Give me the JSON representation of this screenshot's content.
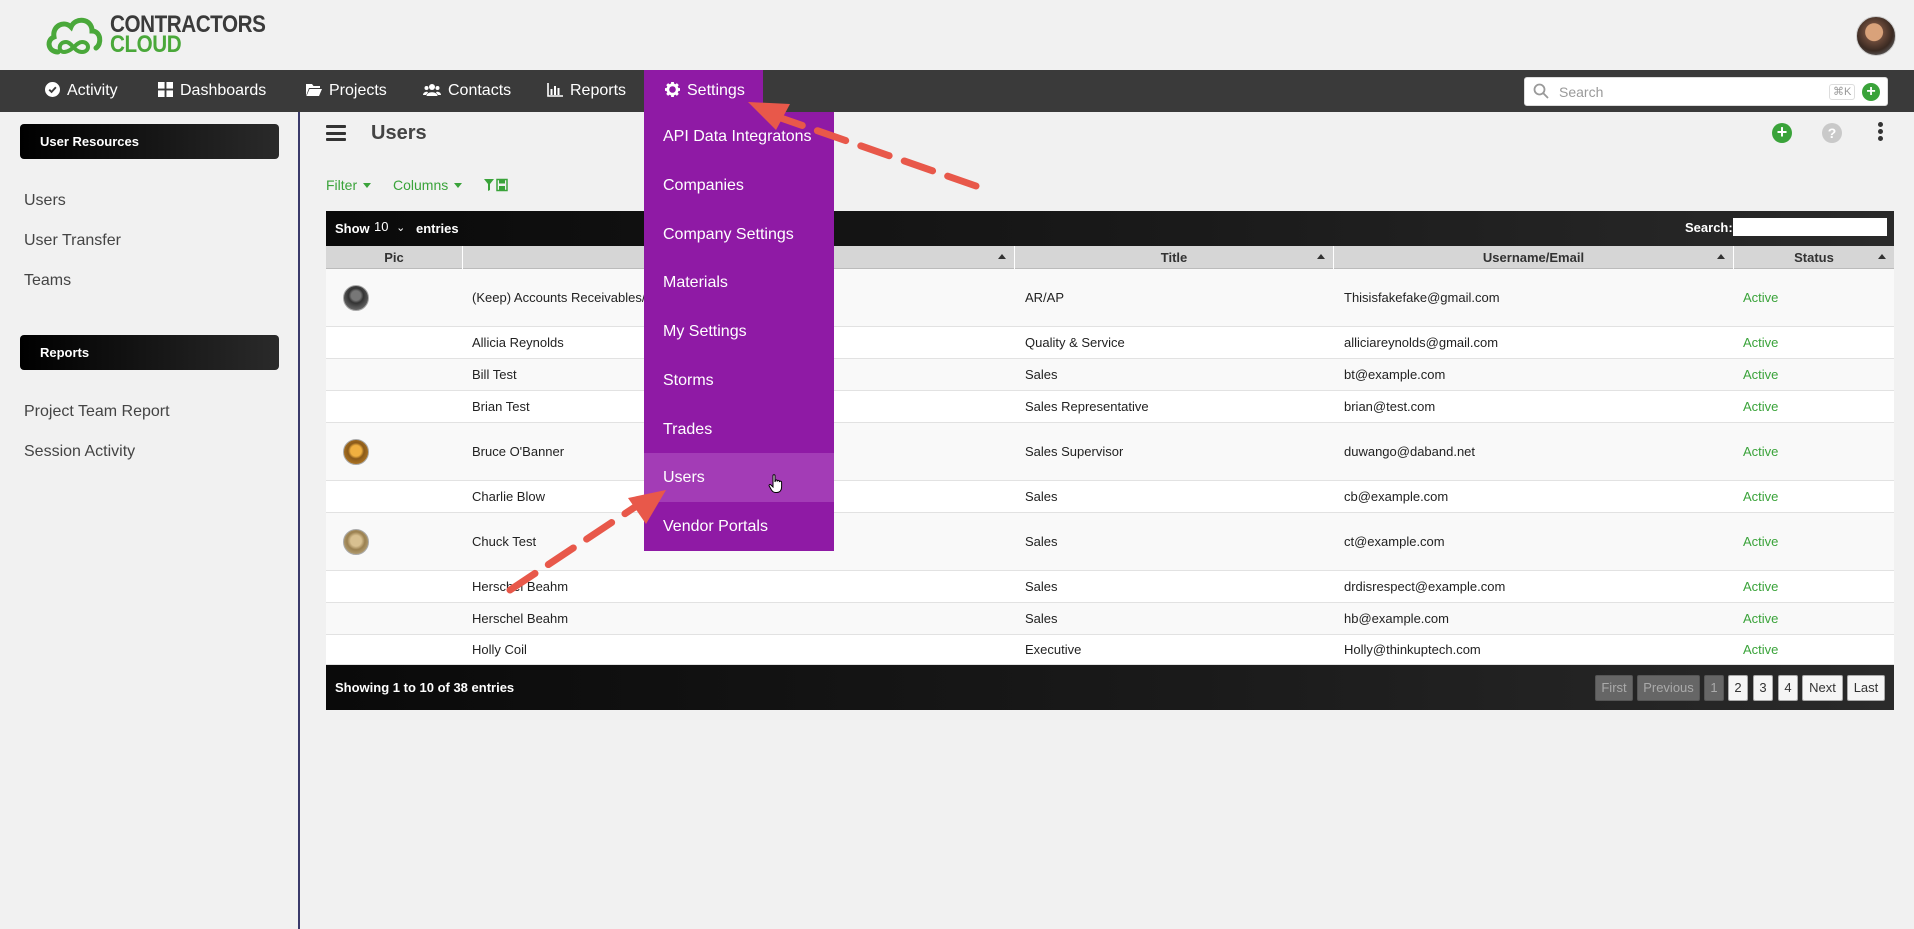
{
  "app": {
    "logo_line1": "CONTRACTORS",
    "logo_line2": "CLOUD",
    "brand_green": "#4aa83a",
    "accent_purple": "#8f1aa5"
  },
  "nav": {
    "items": [
      {
        "label": "Activity",
        "icon": "check-circle-icon"
      },
      {
        "label": "Dashboards",
        "icon": "grid-icon"
      },
      {
        "label": "Projects",
        "icon": "folder-open-icon"
      },
      {
        "label": "Contacts",
        "icon": "users-icon"
      },
      {
        "label": "Reports",
        "icon": "bar-chart-icon"
      },
      {
        "label": "Settings",
        "icon": "gear-icon"
      }
    ],
    "search_placeholder": "Search",
    "search_shortcut": "⌘K"
  },
  "sidebar": {
    "section1_title": "User Resources",
    "section1_items": [
      "Users",
      "User Transfer",
      "Teams"
    ],
    "section2_title": "Reports",
    "section2_items": [
      "Project Team Report",
      "Session Activity"
    ]
  },
  "page": {
    "title": "Users",
    "filter_label": "Filter",
    "columns_label": "Columns"
  },
  "table": {
    "show_label": "Show",
    "page_size": "10",
    "entries_label": "entries",
    "search_label": "Search:",
    "columns": [
      "Pic",
      "",
      "Title",
      "Username/Email",
      "Status"
    ],
    "rows": [
      {
        "name": "(Keep) Accounts Receivables/",
        "title": "AR/AP",
        "email": "Thisisfakefake@gmail.com",
        "status": "Active",
        "pic": "avatar-dark"
      },
      {
        "name": "Allicia Reynolds",
        "title": "Quality & Service",
        "email": "alliciareynolds@gmail.com",
        "status": "Active",
        "pic": ""
      },
      {
        "name": "Bill Test",
        "title": "Sales",
        "email": "bt@example.com",
        "status": "Active",
        "pic": ""
      },
      {
        "name": "Brian Test",
        "title": "Sales Representative",
        "email": "brian@test.com",
        "status": "Active",
        "pic": ""
      },
      {
        "name": "Bruce O'Banner",
        "title": "Sales Supervisor",
        "email": "duwango@daband.net",
        "status": "Active",
        "pic": "avatar-orange"
      },
      {
        "name": "Charlie Blow",
        "title": "Sales",
        "email": "cb@example.com",
        "status": "Active",
        "pic": ""
      },
      {
        "name": "Chuck Test",
        "title": "Sales",
        "email": "ct@example.com",
        "status": "Active",
        "pic": "avatar-tan"
      },
      {
        "name": "Herschel Beahm",
        "title": "Sales",
        "email": "drdisrespect@example.com",
        "status": "Active",
        "pic": ""
      },
      {
        "name": "Herschel Beahm",
        "title": "Sales",
        "email": "hb@example.com",
        "status": "Active",
        "pic": ""
      },
      {
        "name": "Holly Coil",
        "title": "Executive",
        "email": "Holly@thinkuptech.com",
        "status": "Active",
        "pic": ""
      }
    ],
    "info": "Showing 1 to 10 of 38 entries",
    "pagination": [
      "First",
      "Previous",
      "1",
      "2",
      "3",
      "4",
      "Next",
      "Last"
    ]
  },
  "settings_menu": {
    "items": [
      "API Data Integratons",
      "Companies",
      "Company Settings",
      "Materials",
      "My Settings",
      "Storms",
      "Trades",
      "Users",
      "Vendor Portals"
    ],
    "hovered": "Users"
  }
}
